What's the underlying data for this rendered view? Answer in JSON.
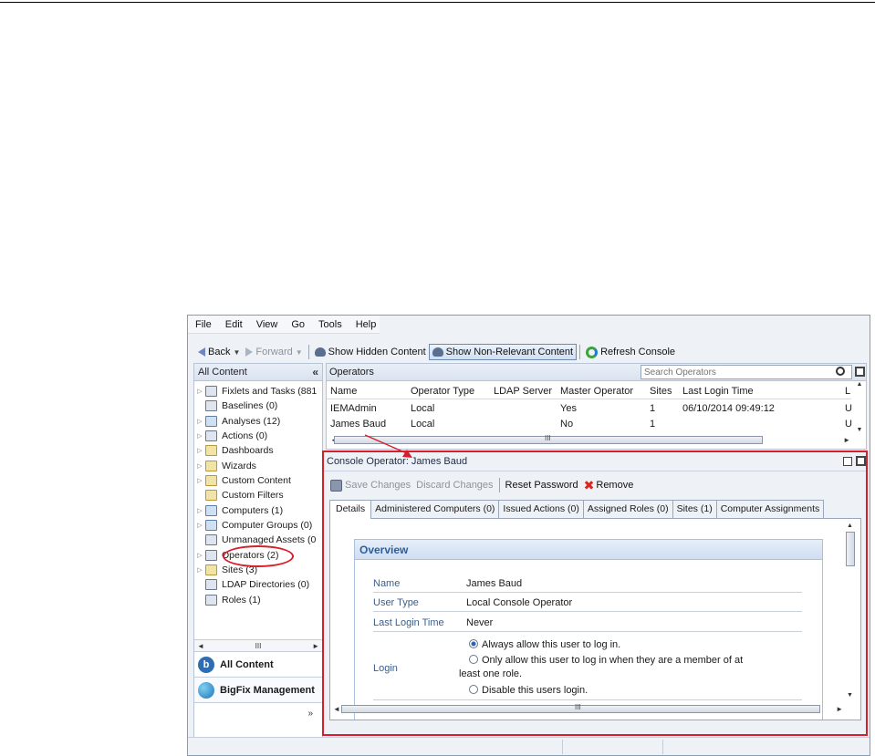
{
  "menu": [
    "File",
    "Edit",
    "View",
    "Go",
    "Tools",
    "Help"
  ],
  "toolbar": {
    "back": "Back",
    "forward": "Forward",
    "show_hidden": "Show Hidden Content",
    "show_non_relevant": "Show Non-Relevant Content",
    "refresh": "Refresh Console"
  },
  "left_pane": {
    "title": "All Content",
    "collapse_label": "«",
    "tree": [
      {
        "label": "Fixlets and Tasks (881",
        "expandable": true
      },
      {
        "label": "Baselines (0)",
        "expandable": false
      },
      {
        "label": "Analyses (12)",
        "expandable": true
      },
      {
        "label": "Actions (0)",
        "expandable": true
      },
      {
        "label": "Dashboards",
        "expandable": true
      },
      {
        "label": "Wizards",
        "expandable": true
      },
      {
        "label": "Custom Content",
        "expandable": true
      },
      {
        "label": "Custom Filters",
        "expandable": false
      },
      {
        "label": "Computers (1)",
        "expandable": true
      },
      {
        "label": "Computer Groups (0)",
        "expandable": true
      },
      {
        "label": "Unmanaged Assets (0",
        "expandable": false
      },
      {
        "label": "Operators (2)",
        "expandable": true
      },
      {
        "label": "Sites (3)",
        "expandable": true
      },
      {
        "label": "LDAP Directories (0)",
        "expandable": false
      },
      {
        "label": "Roles (1)",
        "expandable": false
      }
    ],
    "hscroll_grip": "III",
    "nav": [
      {
        "label": "All Content",
        "icon": "b"
      },
      {
        "label": "BigFix Management",
        "icon": ""
      }
    ],
    "nav_more": "»"
  },
  "operators": {
    "title": "Operators",
    "search_placeholder": "Search Operators",
    "columns": [
      "Name",
      "Operator Type",
      "LDAP Server",
      "Master Operator",
      "Sites",
      "Last Login Time",
      "L"
    ],
    "rows": [
      [
        "IEMAdmin",
        "Local",
        "",
        "Yes",
        "1",
        "06/10/2014 09:49:12",
        "U"
      ],
      [
        "James Baud",
        "Local",
        "",
        "No",
        "1",
        "",
        "U"
      ]
    ],
    "hscroll_grip": "III"
  },
  "console_operator": {
    "title": "Console Operator: James Baud",
    "toolbar": {
      "save": "Save Changes",
      "discard": "Discard Changes",
      "reset": "Reset Password",
      "remove": "Remove"
    },
    "tabs": [
      "Details",
      "Administered Computers (0)",
      "Issued Actions (0)",
      "Assigned Roles (0)",
      "Sites (1)",
      "Computer Assignments"
    ],
    "overview": {
      "heading": "Overview",
      "name_label": "Name",
      "name_value": "James Baud",
      "user_type_label": "User Type",
      "user_type_value": "Local Console Operator",
      "last_login_label": "Last Login Time",
      "last_login_value": "Never",
      "login_label": "Login",
      "login_options": [
        "Always allow this user to log in.",
        "Only allow this user to log in when they are a member of at",
        "least one role.",
        "Disable this users login."
      ]
    },
    "hscroll_grip": "III"
  },
  "colors": {
    "annotation_red": "#d61f2a",
    "overview_header_text": "#2b5e9c",
    "label_text": "#3b5d8c"
  }
}
